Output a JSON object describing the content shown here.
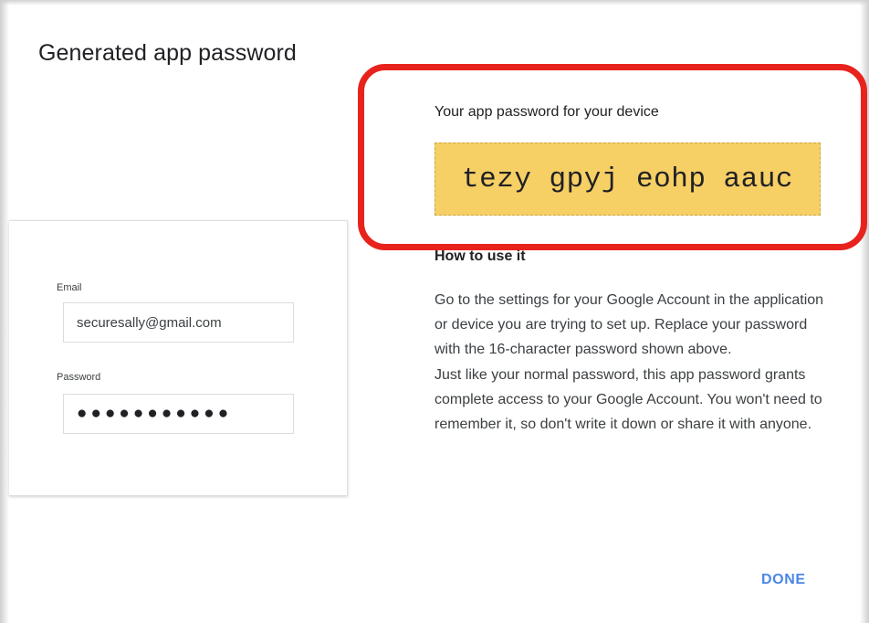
{
  "dialog": {
    "title": "Generated app password"
  },
  "device_form": {
    "email_label": "Email",
    "email_value": "securesally@gmail.com",
    "password_label": "Password",
    "password_mask": "●●●●●●●●●●●"
  },
  "app_password": {
    "heading": "Your app password for your device",
    "value": "tezy gpyj eohp aauc"
  },
  "how_to": {
    "heading": "How to use it",
    "paragraph1": "Go to the settings for your Google Account in the application or device you are trying to set up. Replace your password with the 16-character password shown above.",
    "paragraph2": "Just like your normal password, this app password grants complete access to your Google Account. You won't need to remember it, so don't write it down or share it with anyone."
  },
  "actions": {
    "done_label": "DONE"
  },
  "colors": {
    "password_highlight": "#f6cf65",
    "accent_blue": "#4a86e8",
    "annotation_red": "#e8231d"
  }
}
